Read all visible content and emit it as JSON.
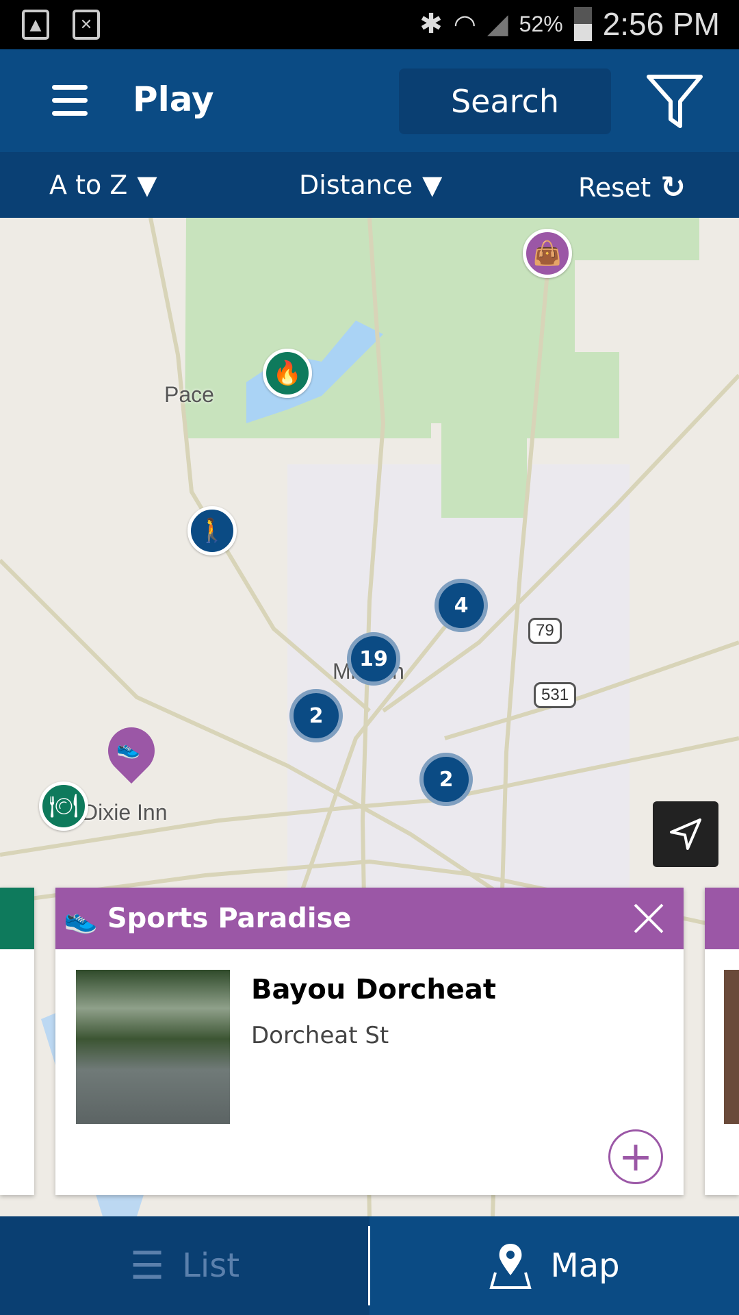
{
  "status_bar": {
    "battery": "52%",
    "time": "2:56 PM",
    "icons": [
      "gallery-icon",
      "sim-error-icon",
      "bluetooth-icon",
      "wifi-icon",
      "signal-icon",
      "battery-icon"
    ]
  },
  "header": {
    "title": "Play",
    "search_label": "Search",
    "filter_icon": "filter-icon",
    "menu_icon": "hamburger-icon"
  },
  "sort_bar": {
    "alpha": "A to Z",
    "distance": "Distance",
    "reset": "Reset"
  },
  "map": {
    "labels": {
      "pace": "Pace",
      "minden": "Minden",
      "dixie": "Dixie Inn"
    },
    "shields": {
      "us79": "79",
      "r531": "531"
    },
    "clusters": [
      "4",
      "19",
      "2",
      "2"
    ],
    "markers": [
      {
        "type": "shopping",
        "color": "#9b57a6"
      },
      {
        "type": "campground",
        "color": "#0e7a5c"
      },
      {
        "type": "hiker",
        "color": "#0b4b84"
      },
      {
        "type": "sports",
        "color": "#9b57a6"
      },
      {
        "type": "restaurant",
        "color": "#0e7a5c"
      }
    ]
  },
  "card": {
    "category": "Sports Paradise",
    "name": "Bayou Dorcheat",
    "address": "Dorcheat St",
    "accent": "#9b57a6"
  },
  "bottom_nav": {
    "list": "List",
    "map": "Map",
    "active": "Map"
  }
}
